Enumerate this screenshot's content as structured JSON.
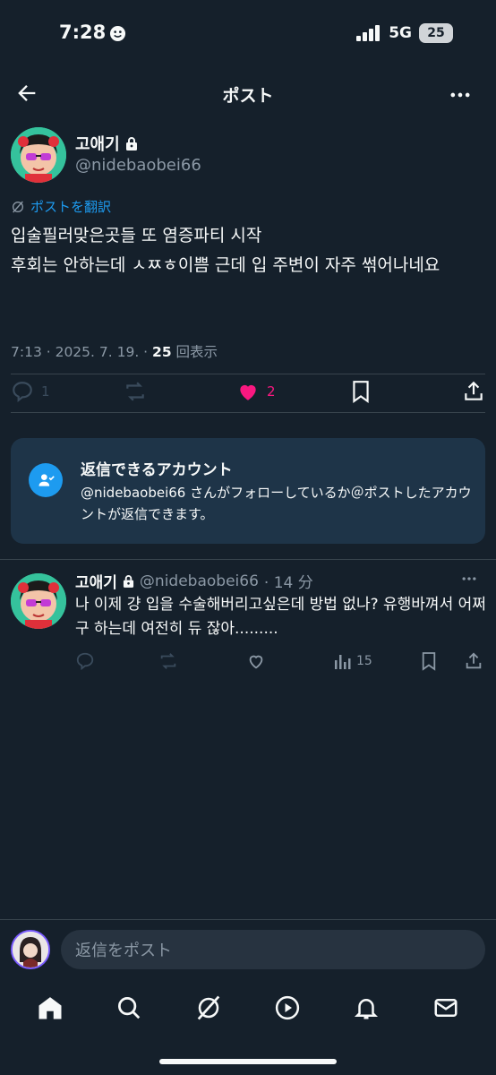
{
  "status_bar": {
    "time": "7:28",
    "network": "5G",
    "battery": "25"
  },
  "header": {
    "title": "ポスト"
  },
  "post": {
    "author_name": "고애기",
    "author_handle": "@nidebaobei66",
    "translate_label": "ポストを翻訳",
    "text_line1": "입술필러맞은곳들 또 염증파티 시작",
    "text_line2": "후회는 안하는데 ㅅㅉㅎ이쁨 근데 입 주변이 자주 썪어나네요",
    "meta_prefix": "7:13 · 2025. 7. 19. · ",
    "view_count": "25",
    "view_label": " 回表示",
    "reply_count": "1",
    "like_count": "2"
  },
  "reply_card": {
    "title": "返信できるアカウント",
    "body": "@nidebaobei66 さんがフォローしているか＠ポストしたアカウントが返信できます。"
  },
  "reply": {
    "author_name": "고애기",
    "author_handle": "@nidebaobei66",
    "time": "· 14 分",
    "text": "나 이제 걍 입을 수술해버리고싶은데 방법 없나? 유행바껴서 어쩌구 하는데 여전히 듀 잖아.........",
    "views": "15"
  },
  "composer": {
    "placeholder": "返信をポスト"
  },
  "colors": {
    "background": "#15202b",
    "accent": "#1d9bf0",
    "like": "#f91880",
    "muted": "#8b98a5"
  }
}
